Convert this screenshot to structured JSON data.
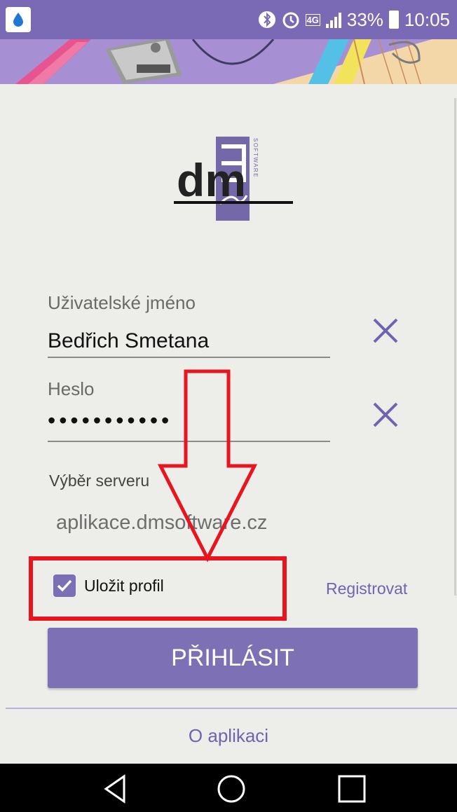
{
  "status_bar": {
    "battery_percent": "33%",
    "time": "10:05",
    "network": "4G",
    "icons": [
      "bluetooth-icon",
      "alarm-icon",
      "network-4g-icon",
      "signal-icon",
      "battery-icon"
    ]
  },
  "login_form": {
    "username": {
      "label": "Uživatelské jméno",
      "value": "Bedřich Smetana"
    },
    "password": {
      "label": "Heslo",
      "value": "•••••••••••"
    },
    "server": {
      "label": "Výběr serveru",
      "value": "aplikace.dmsoftware.cz"
    },
    "save_profile": {
      "label": "Uložit profil",
      "checked": true
    },
    "register_label": "Registrovat",
    "login_label": "PŘIHLÁSIT"
  },
  "footer": {
    "about_label": "O aplikaci"
  },
  "logo": {
    "brand": "dm",
    "tagline": "SOFTWARE"
  },
  "colors": {
    "accent": "#7d70b4",
    "status_bar": "#7a6ab5",
    "annotation": "#e8141e"
  }
}
